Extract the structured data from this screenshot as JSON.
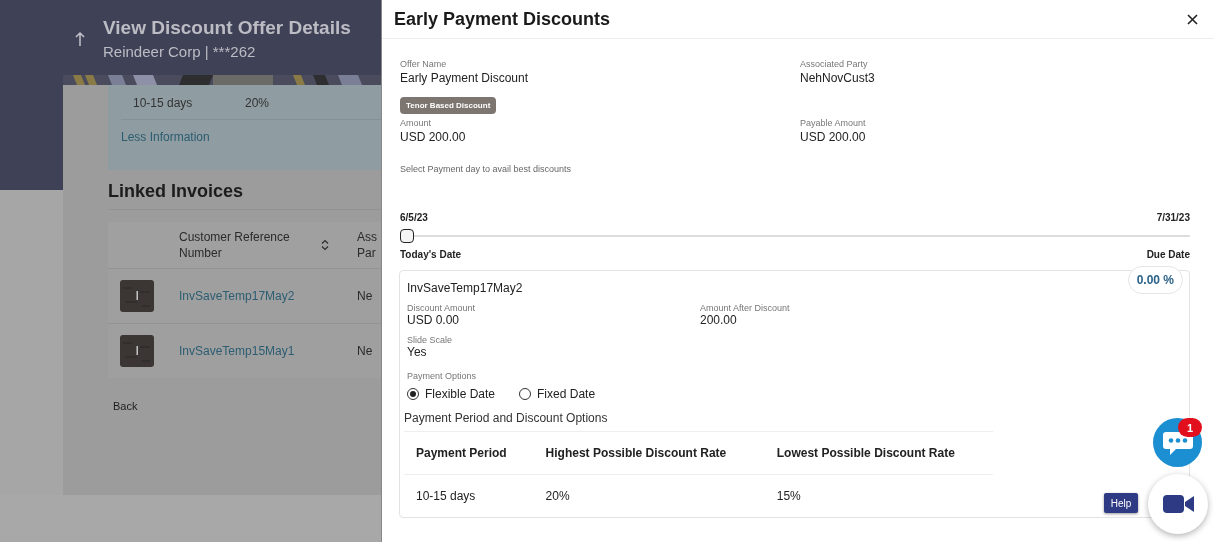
{
  "background_page": {
    "title": "View Discount Offer Details",
    "subtitle": "Reindeer Corp | ***262",
    "tenor_row": [
      "10-15 days",
      "20%"
    ],
    "less_information_link": "Less Information",
    "section_title": "Linked Invoices",
    "table": {
      "columns": [
        "Customer Reference Number",
        "Ass Par"
      ],
      "rows": [
        {
          "reference": "InvSaveTemp17May2",
          "column_2": "Ne"
        },
        {
          "reference": "InvSaveTemp15May1",
          "column_2": "Ne"
        }
      ]
    },
    "back_button": "Back"
  },
  "modal": {
    "title": "Early Payment Discounts",
    "fields": [
      {
        "label": "Offer Name",
        "value": "Early Payment Discount"
      },
      {
        "label": "Associated Party",
        "value": "NehNovCust3"
      }
    ],
    "tag": "Tenor Based Discount",
    "amount_fields": [
      {
        "label": "Amount",
        "value": "USD 200.00"
      },
      {
        "label": "Payable Amount",
        "value": "USD 200.00"
      }
    ],
    "hint": "Select Payment day to avail best discounts",
    "slider": {
      "start_label": "6/5/23",
      "end_label": "7/31/23",
      "level": 0,
      "start_caption": "Today's Date",
      "end_caption": "Due Date"
    },
    "discount_badge": "0.00 %",
    "invoice_card": {
      "reference": "InvSaveTemp17May2",
      "fields": [
        {
          "label": "Discount Amount",
          "value": "USD 0.00"
        },
        {
          "label": "Amount After Discount",
          "value": "200.00"
        },
        {
          "label": "Slide Scale",
          "value": "Yes"
        }
      ],
      "payment_options_label": "Payment Options",
      "payment_options": [
        {
          "label": "Flexible Date",
          "selected": true
        },
        {
          "label": "Fixed Date",
          "selected": false
        }
      ],
      "table_title": "Payment Period and Discount Options",
      "table": {
        "columns": [
          "Payment Period",
          "Highest Possible Discount Rate",
          "Lowest Possible Discount Rate"
        ],
        "rows": [
          [
            "10-15 days",
            "20%",
            "15%"
          ]
        ]
      }
    }
  },
  "floating": {
    "chat_badge": "1",
    "help_button": "Help"
  }
}
